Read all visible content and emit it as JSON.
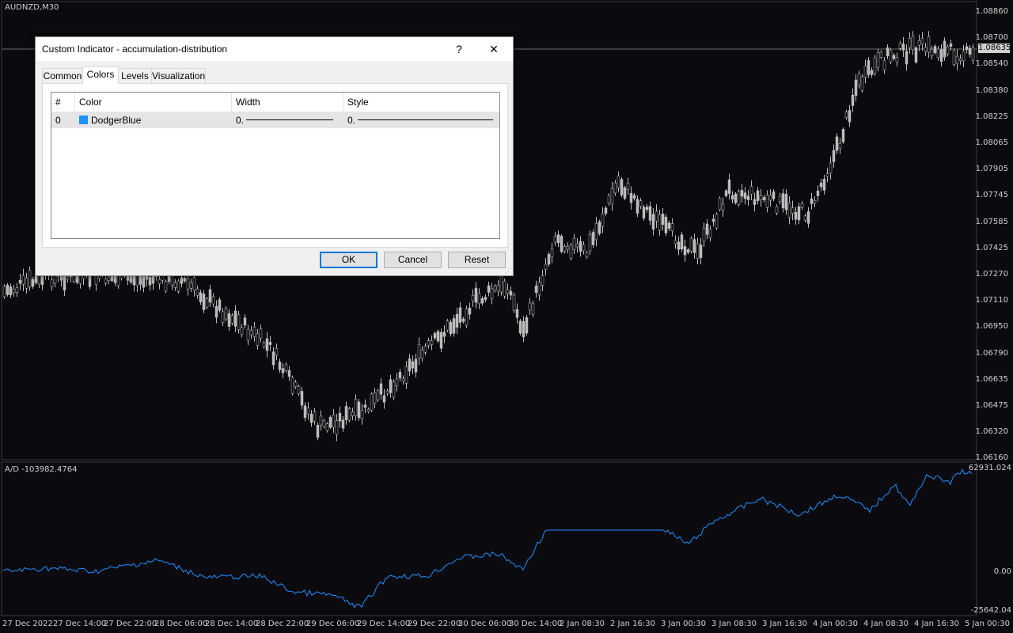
{
  "chart": {
    "symbol_label": "AUDNZD,M30",
    "current_price": "1.08635",
    "price_ticks": [
      "1.08860",
      "1.08700",
      "1.08540",
      "1.08380",
      "1.08225",
      "1.08065",
      "1.07905",
      "1.07745",
      "1.07585",
      "1.07425",
      "1.07270",
      "1.07110",
      "1.06950",
      "1.06790",
      "1.06635",
      "1.06475",
      "1.06320",
      "1.06160"
    ],
    "indicator_label": "A/D -103982.4764",
    "indicator_ticks": [
      "62931.024",
      "0.00",
      "-25642.04"
    ],
    "time_ticks": [
      "27 Dec 2022",
      "27 Dec 14:00",
      "27 Dec 22:00",
      "28 Dec 06:00",
      "28 Dec 14:00",
      "28 Dec 22:00",
      "29 Dec 06:00",
      "29 Dec 14:00",
      "29 Dec 22:00",
      "30 Dec 06:00",
      "30 Dec 14:00",
      "2 Jan 08:30",
      "2 Jan 16:30",
      "3 Jan 00:30",
      "3 Jan 08:30",
      "3 Jan 16:30",
      "4 Jan 00:30",
      "4 Jan 08:30",
      "4 Jan 16:30",
      "5 Jan 00:30"
    ],
    "colors": {
      "background": "#0b0b0f",
      "candle": "#bcbcbc",
      "indicator_line": "#1e90ff",
      "grid_line": "#3a3a3a"
    }
  },
  "dialog": {
    "title": "Custom Indicator - accumulation-distribution",
    "help_label": "?",
    "close_label": "✕",
    "tabs": [
      "Common",
      "Colors",
      "Levels",
      "Visualization"
    ],
    "active_tab": "Colors",
    "grid": {
      "headers": [
        "#",
        "Color",
        "Width",
        "Style"
      ],
      "rows": [
        {
          "index": "0",
          "color_name": "DodgerBlue",
          "color_hex": "#1e90ff",
          "width": "0.",
          "style": "0."
        }
      ]
    },
    "buttons": {
      "ok": "OK",
      "cancel": "Cancel",
      "reset": "Reset"
    }
  }
}
